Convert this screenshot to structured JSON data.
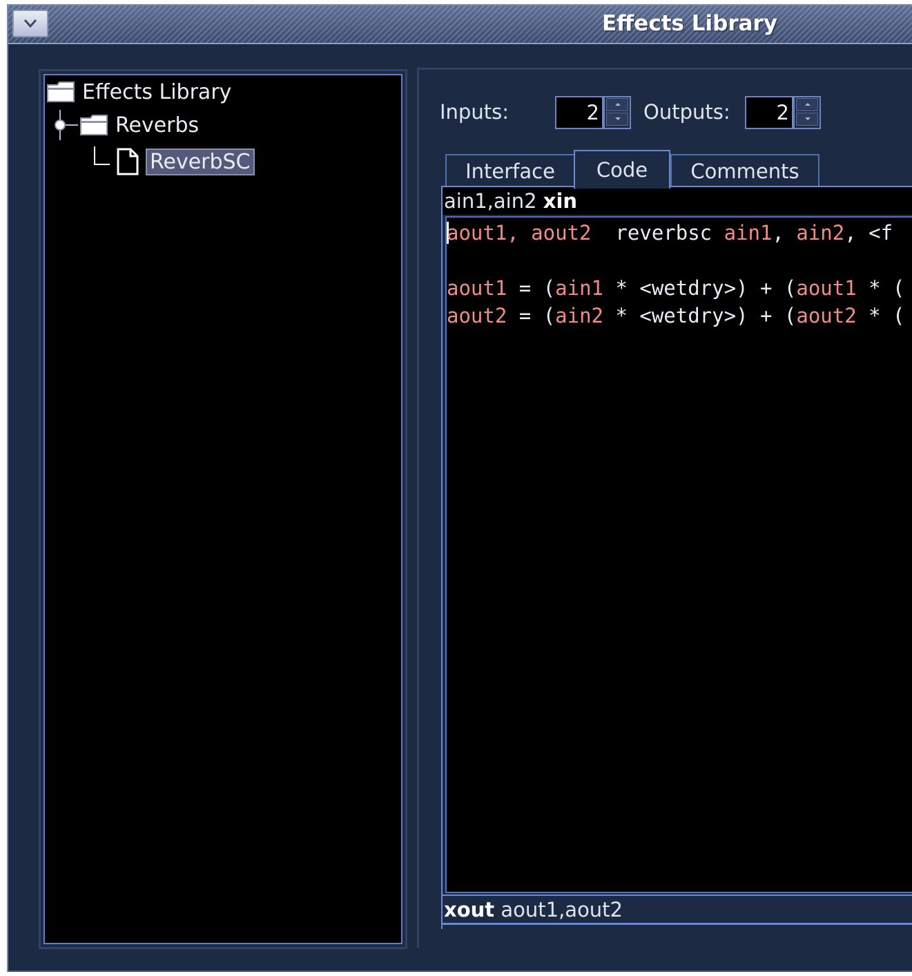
{
  "window": {
    "title": "Effects Library"
  },
  "tree": {
    "root_label": "Effects Library",
    "folder_label": "Reverbs",
    "item_label": "ReverbSC"
  },
  "io": {
    "inputs_label": "Inputs:",
    "inputs_value": "2",
    "outputs_label": "Outputs:",
    "outputs_value": "2"
  },
  "tabs": [
    {
      "label": "Interface",
      "active": false
    },
    {
      "label": "Code",
      "active": true
    },
    {
      "label": "Comments",
      "active": false
    }
  ],
  "code": {
    "header_prefix": "ain1,ain2 ",
    "header_keyword": "xin",
    "lines": [
      [
        {
          "t": "aout1, aout2",
          "c": "var"
        },
        {
          "t": "  reverbsc ",
          "c": "plain"
        },
        {
          "t": "ain1",
          "c": "var"
        },
        {
          "t": ", ",
          "c": "plain"
        },
        {
          "t": "ain2",
          "c": "var"
        },
        {
          "t": ", <f",
          "c": "plain"
        }
      ],
      [],
      [
        {
          "t": "aout1",
          "c": "var"
        },
        {
          "t": " = (",
          "c": "plain"
        },
        {
          "t": "ain1",
          "c": "var"
        },
        {
          "t": " * <wetdry>) + (",
          "c": "plain"
        },
        {
          "t": "aout1",
          "c": "var"
        },
        {
          "t": " * (",
          "c": "plain"
        }
      ],
      [
        {
          "t": "aout2",
          "c": "var"
        },
        {
          "t": " = (",
          "c": "plain"
        },
        {
          "t": "ain2",
          "c": "var"
        },
        {
          "t": " * <wetdry>) + (",
          "c": "plain"
        },
        {
          "t": "aout2",
          "c": "var"
        },
        {
          "t": " * (",
          "c": "plain"
        }
      ]
    ],
    "footer_keyword": "xout",
    "footer_suffix": " aout1,aout2"
  },
  "colors": {
    "background": "#1c2a44",
    "editor_bg": "#000000",
    "variable": "#f08c84",
    "text": "#e8ecf4",
    "accent_border": "#6a8ad0"
  }
}
